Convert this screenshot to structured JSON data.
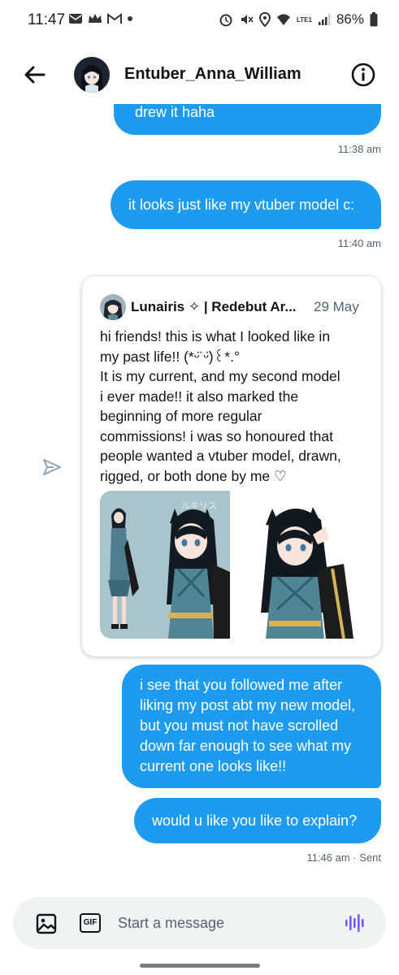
{
  "status_bar": {
    "time": "11:47",
    "battery": "86%",
    "network": "LTE1"
  },
  "header": {
    "title": "Entuber_Anna_William"
  },
  "messages": [
    {
      "text": "drew it haha",
      "time": "11:38 am"
    },
    {
      "text": "it looks just like my vtuber model c:",
      "time": "11:40 am"
    },
    {
      "text": "i see that you followed me after liking my post abt my new model, but you must not have scrolled down far enough to see what my current one looks like!!"
    },
    {
      "text": "would u like you like to explain?",
      "time": "11:46 am · Sent"
    }
  ],
  "shared_tweet": {
    "author": "Lunairis ✧ | Redebut Ar...",
    "date": "29 May",
    "lines": [
      "hi friends! this is what I looked like in",
      "my past life!! (*ᵕ̈ ᵕ̈)꒰*.°",
      "It is my current, and my second model",
      "i ever made!! it also marked the",
      "beginning of more regular",
      "commissions! i was so honoured that",
      "people wanted a vtuber model, drawn,",
      "rigged, or both done by me ♡"
    ],
    "image_watermark": "ルキリス"
  },
  "composer": {
    "placeholder": "Start a message",
    "gif_label": "GIF"
  },
  "colors": {
    "accent": "#1d9bf0",
    "text": "#0f1419",
    "muted": "#536471"
  }
}
